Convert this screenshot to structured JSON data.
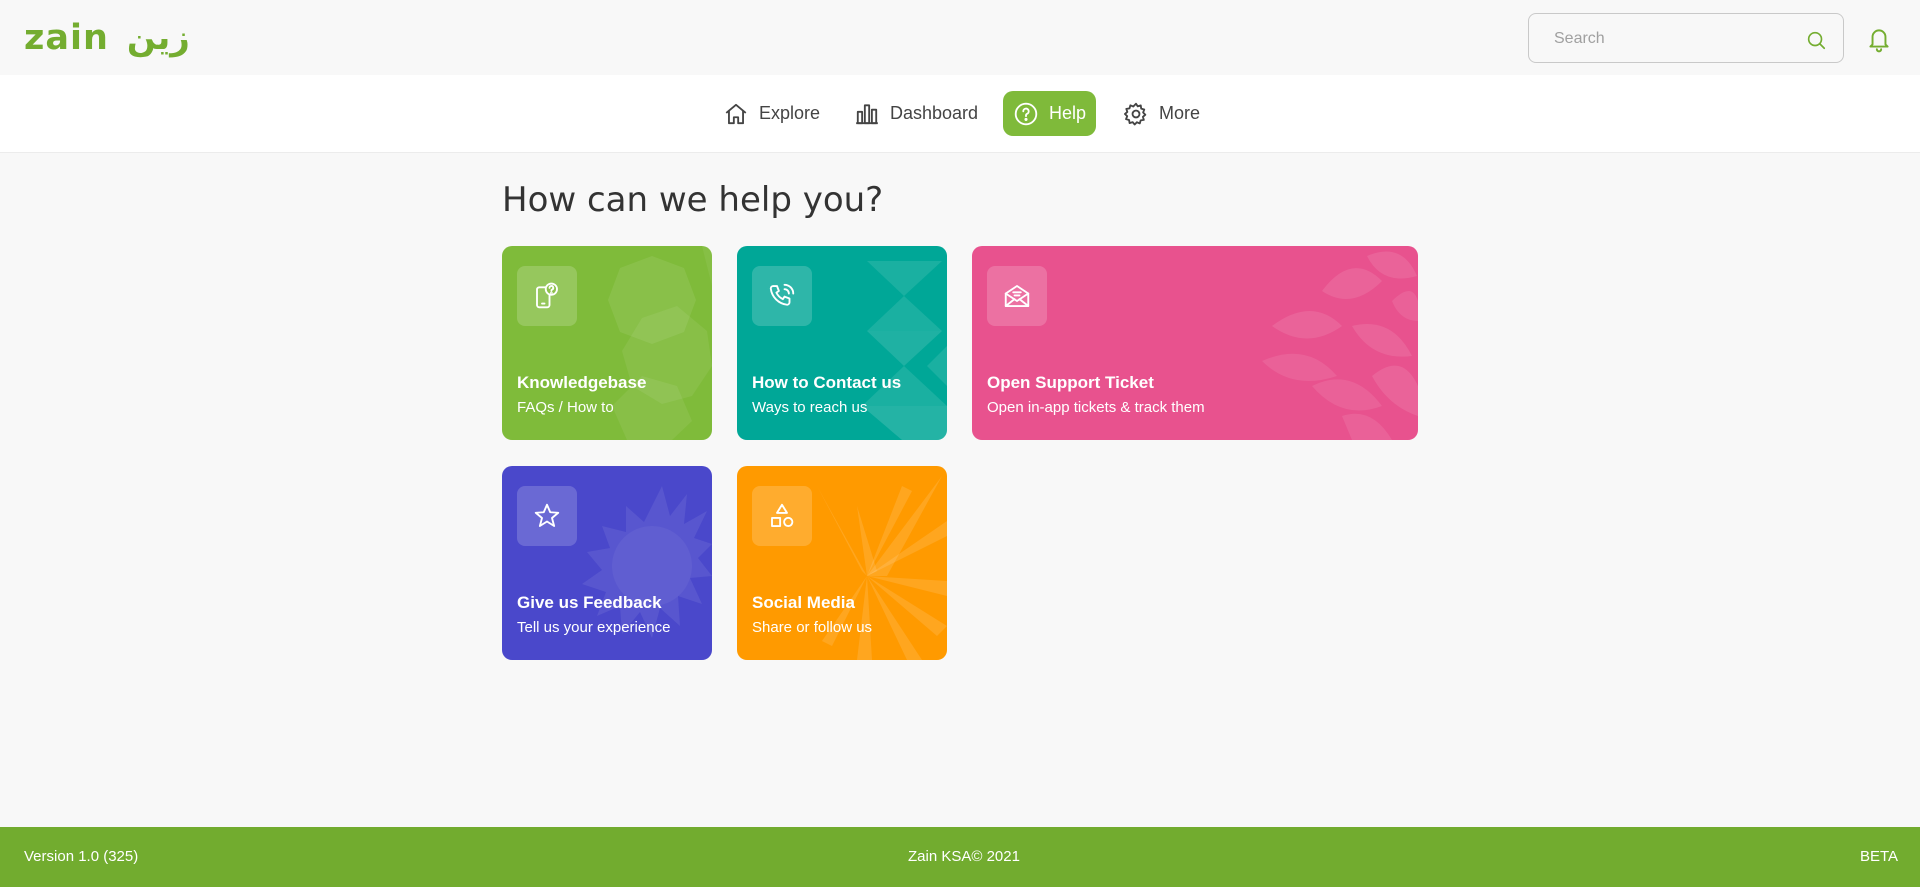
{
  "brand": {
    "logo_latin": "zain",
    "logo_arabic": "زين",
    "accent": "#74ad30"
  },
  "header": {
    "search_placeholder": "Search",
    "search_icon": "search-icon",
    "notification_icon": "bell-icon"
  },
  "nav": {
    "items": [
      {
        "label": "Explore",
        "icon": "home-icon",
        "active": false
      },
      {
        "label": "Dashboard",
        "icon": "bar-chart-icon",
        "active": false
      },
      {
        "label": "Help",
        "icon": "question-circle-icon",
        "active": true
      },
      {
        "label": "More",
        "icon": "gear-icon",
        "active": false
      }
    ]
  },
  "main": {
    "title": "How can we help you?",
    "cards": [
      {
        "title": "Knowledgebase",
        "subtitle": "FAQs / How to",
        "icon": "phone-question-icon",
        "color": "#7fbb3a"
      },
      {
        "title": "How to Contact us",
        "subtitle": "Ways to reach us",
        "icon": "phone-call-icon",
        "color": "#00a797"
      },
      {
        "title": "Open Support Ticket",
        "subtitle": "Open in-app tickets & track them",
        "icon": "envelope-icon",
        "color": "#e8528e"
      },
      {
        "title": "Give us Feedback",
        "subtitle": "Tell us your experience",
        "icon": "star-icon",
        "color": "#4a48cb"
      },
      {
        "title": "Social Media",
        "subtitle": "Share or follow us",
        "icon": "shapes-icon",
        "color": "#ff9a00"
      }
    ]
  },
  "footer": {
    "version": "Version 1.0 (325)",
    "copyright": "Zain KSA© 2021",
    "badge": "BETA",
    "color": "#72ac2f"
  }
}
